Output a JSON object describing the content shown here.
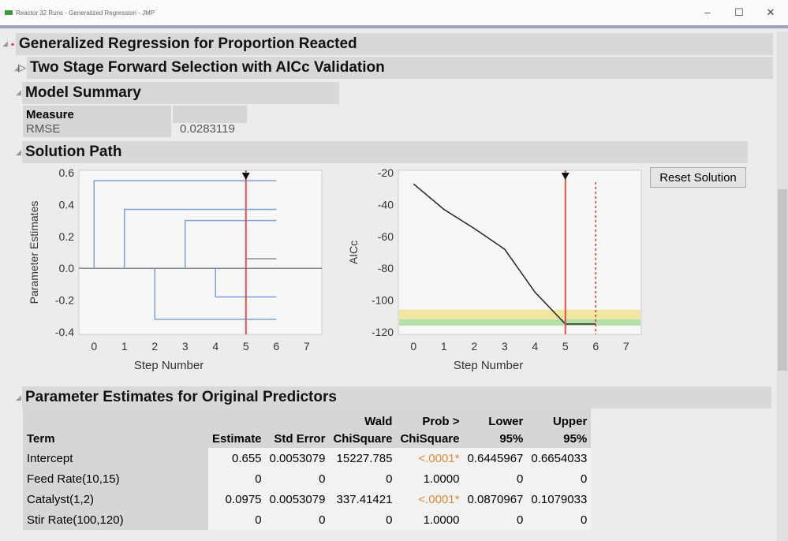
{
  "window": {
    "title": "Reactor 32 Runs - Generalized Regression - JMP",
    "min": "–",
    "max": "☐",
    "close": "✕"
  },
  "report": {
    "title": "Generalized Regression for Proportion Reacted",
    "subtitle": "Two Stage Forward Selection with AICc Validation",
    "model_summary": {
      "title": "Model Summary",
      "measure_header": "Measure",
      "rows": [
        {
          "label": "RMSE",
          "value": "0.0283119"
        }
      ]
    },
    "solution_path": {
      "title": "Solution Path",
      "reset_button": "Reset Solution"
    },
    "estimates": {
      "title": "Parameter Estimates for Original Predictors",
      "headers": [
        "Term",
        "Estimate",
        "Std Error",
        "Wald ChiSquare",
        "Prob > ChiSquare",
        "Lower 95%",
        "Upper 95%"
      ],
      "rows": [
        [
          "Intercept",
          "0.655",
          "0.0053079",
          "15227.785",
          "<.0001*",
          "0.6445967",
          "0.6654033"
        ],
        [
          "Feed Rate(10,15)",
          "0",
          "0",
          "0",
          "1.0000",
          "0",
          "0"
        ],
        [
          "Catalyst(1,2)",
          "0.0975",
          "0.0053079",
          "337.41421",
          "<.0001*",
          "0.0870967",
          "0.1079033"
        ],
        [
          "Stir Rate(100,120)",
          "0",
          "0",
          "0",
          "1.0000",
          "0",
          "0"
        ]
      ]
    }
  },
  "chart_data": [
    {
      "type": "line",
      "title": "Parameter Estimates path",
      "xlabel": "Step Number",
      "ylabel": "Parameter Estimates",
      "xlim": [
        -0.5,
        7.5
      ],
      "ylim": [
        -0.4,
        0.6
      ],
      "xticks": [
        "0",
        "1",
        "2",
        "3",
        "4",
        "5",
        "6",
        "7"
      ],
      "yticks": [
        "0.6",
        "0.4",
        "0.2",
        "0.0",
        "-0.2",
        "-0.4"
      ],
      "selected_step": 5,
      "series": [
        {
          "enter": 0,
          "value": 0.55,
          "color": "#7e9fd6"
        },
        {
          "enter": 1,
          "value": 0.37,
          "color": "#7e9fd6"
        },
        {
          "enter": 2,
          "value": -0.32,
          "color": "#7e9fd6"
        },
        {
          "enter": 3,
          "value": 0.3,
          "color": "#7e9fd6"
        },
        {
          "enter": 4,
          "value": -0.18,
          "color": "#7e9fd6"
        },
        {
          "enter": 5,
          "value": 0.06,
          "color": "#888888"
        }
      ]
    },
    {
      "type": "line",
      "title": "AICc path",
      "xlabel": "Step Number",
      "ylabel": "AICc",
      "xlim": [
        -0.5,
        7.5
      ],
      "ylim": [
        -120,
        -20
      ],
      "xticks": [
        "0",
        "1",
        "2",
        "3",
        "4",
        "5",
        "6",
        "7"
      ],
      "yticks": [
        "-20",
        "-40",
        "-60",
        "-80",
        "-100",
        "-120"
      ],
      "selected_step": 5,
      "max_step": 6,
      "x": [
        0,
        1,
        2,
        3,
        4,
        5,
        6
      ],
      "y": [
        -27,
        -43,
        -55,
        -68,
        -95,
        -115,
        -115
      ],
      "bands": [
        {
          "from": -112,
          "to": -106,
          "color": "#f0e6a0"
        },
        {
          "from": -116,
          "to": -112,
          "color": "#b4e0a8"
        }
      ]
    }
  ]
}
